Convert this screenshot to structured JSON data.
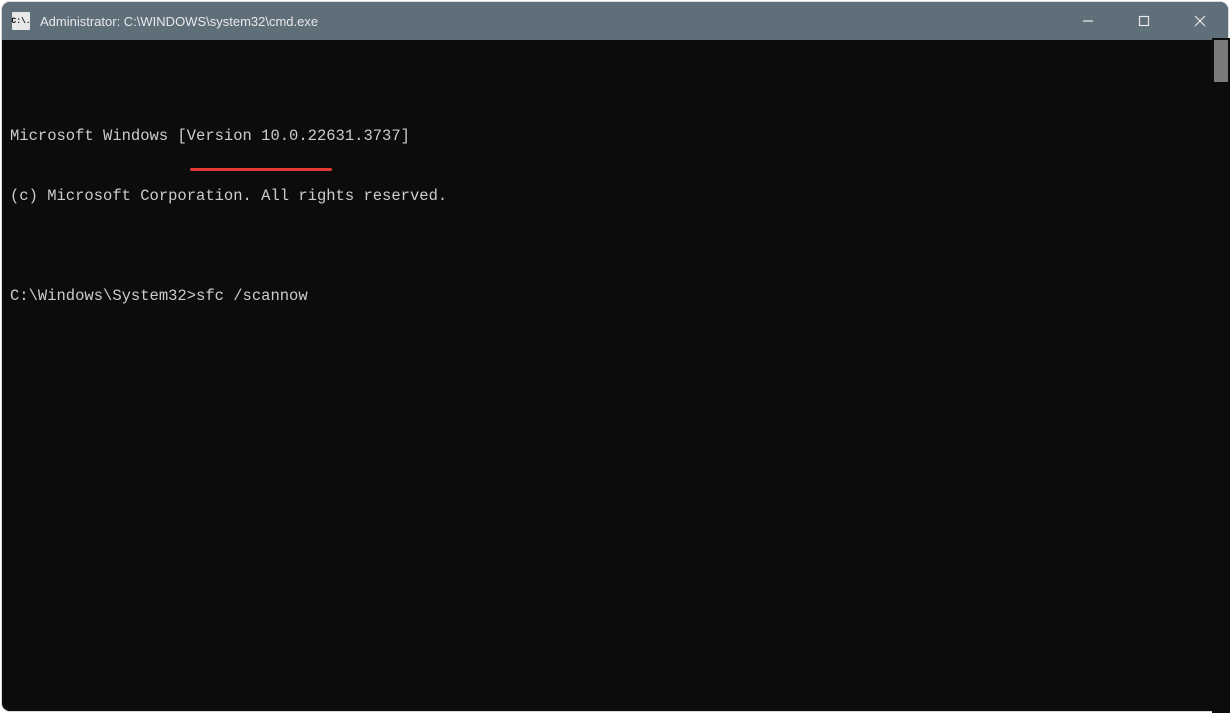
{
  "window": {
    "title": "Administrator: C:\\WINDOWS\\system32\\cmd.exe",
    "icon_text": "C:\\."
  },
  "terminal": {
    "line1": "Microsoft Windows [Version 10.0.22631.3737]",
    "line2": "(c) Microsoft Corporation. All rights reserved.",
    "blank": "",
    "prompt": "C:\\Windows\\System32>",
    "command": "sfc /scannow"
  },
  "annotation": {
    "underline_color": "#e53935"
  }
}
